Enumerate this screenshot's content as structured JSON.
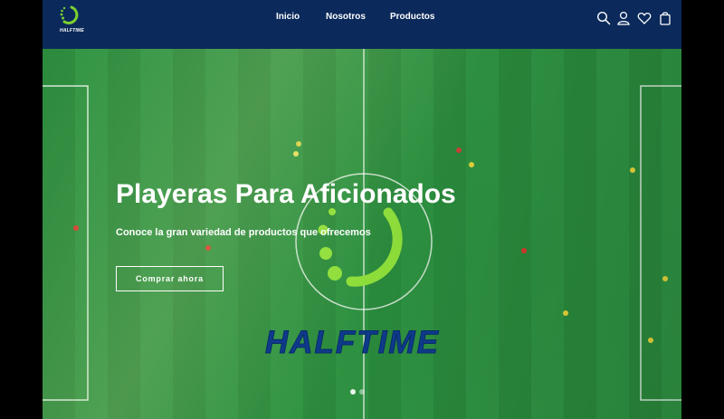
{
  "brand": {
    "logo_text": "HALFTIME",
    "accent": "#7cd12f",
    "navy": "#0b2a5b"
  },
  "nav": {
    "items": [
      "Inicio",
      "Nosotros",
      "Productos"
    ]
  },
  "header_icons": [
    "search-icon",
    "user-icon",
    "heart-icon",
    "bag-icon"
  ],
  "hero": {
    "title": "Playeras Para Aficionados",
    "subtitle": "Conoce la gran variedad de productos que ofrecemos",
    "cta": "Comprar ahora",
    "brand_wordmark": "HALFTIME",
    "slide_count": 2,
    "active_slide": 1
  }
}
